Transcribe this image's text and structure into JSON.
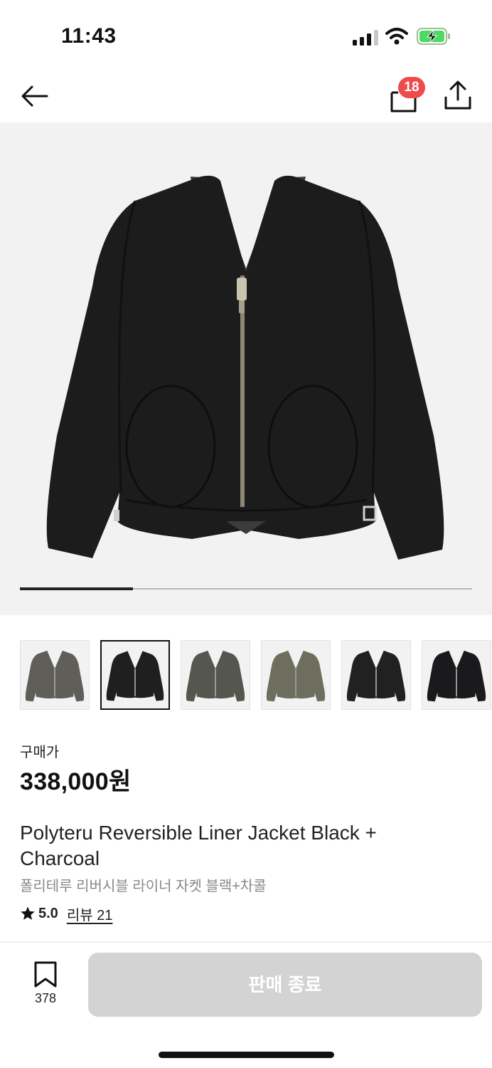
{
  "status_bar": {
    "time": "11:43"
  },
  "nav": {
    "cart_count": "18",
    "icons": [
      "arrow-left-icon",
      "shopping-bag-icon",
      "share-icon"
    ]
  },
  "gallery": {
    "current_index": 1,
    "total": 6,
    "progress_fraction": 0.25,
    "thumbnails": [
      {
        "color": "#5f5e59"
      },
      {
        "color": "#1f1f1f"
      },
      {
        "color": "#55564d"
      },
      {
        "color": "#6d6e5d"
      },
      {
        "color": "#212121"
      },
      {
        "color": "#1a1a1c"
      }
    ]
  },
  "price": {
    "label": "구매가",
    "value": "338,000원"
  },
  "product": {
    "title_en": "Polyteru Reversible Liner Jacket Black + Charcoal",
    "title_ko": "폴리테루 리버시블 라이너 자켓 블랙+차콜",
    "rating": "5.0",
    "review_link": "리뷰 21"
  },
  "bottom_bar": {
    "bookmark_count": "378",
    "cta_label": "판매 종료"
  },
  "colors": {
    "badge": "#ee4b4b",
    "cta_disabled": "#d3d3d3",
    "subtle_text": "#888888"
  }
}
